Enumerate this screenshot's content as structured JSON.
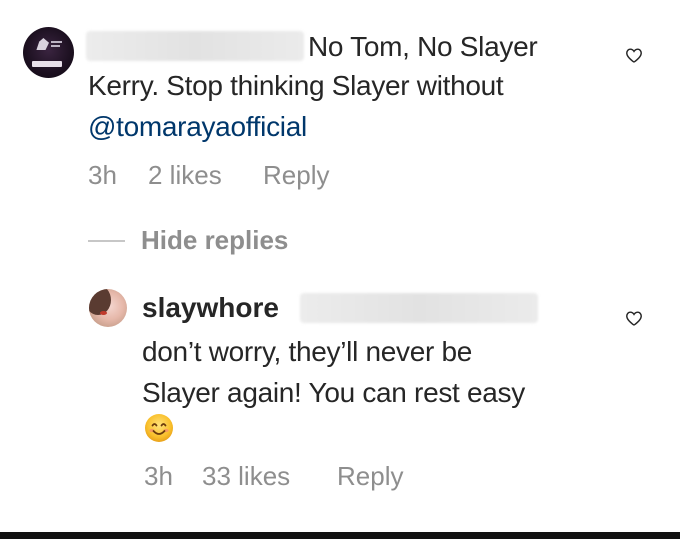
{
  "comment": {
    "text_line1": "No Tom, No Slayer",
    "text_line2": "Kerry. Stop thinking Slayer without",
    "mention": "@tomarayaofficial",
    "time": "3h",
    "likes": "2 likes",
    "reply_label": "Reply"
  },
  "hide_replies_label": "Hide replies",
  "reply": {
    "username": "slaywhore",
    "text_line1": "don’t worry, they’ll never be",
    "text_line2": "Slayer again! You can rest easy",
    "emoji": "smiling-face-emoji",
    "time": "3h",
    "likes": "33 likes",
    "reply_label": "Reply"
  },
  "icons": {
    "like": "heart-outline-icon"
  },
  "colors": {
    "mention": "#00376b",
    "meta": "#8e8e8e",
    "text": "#262626"
  }
}
